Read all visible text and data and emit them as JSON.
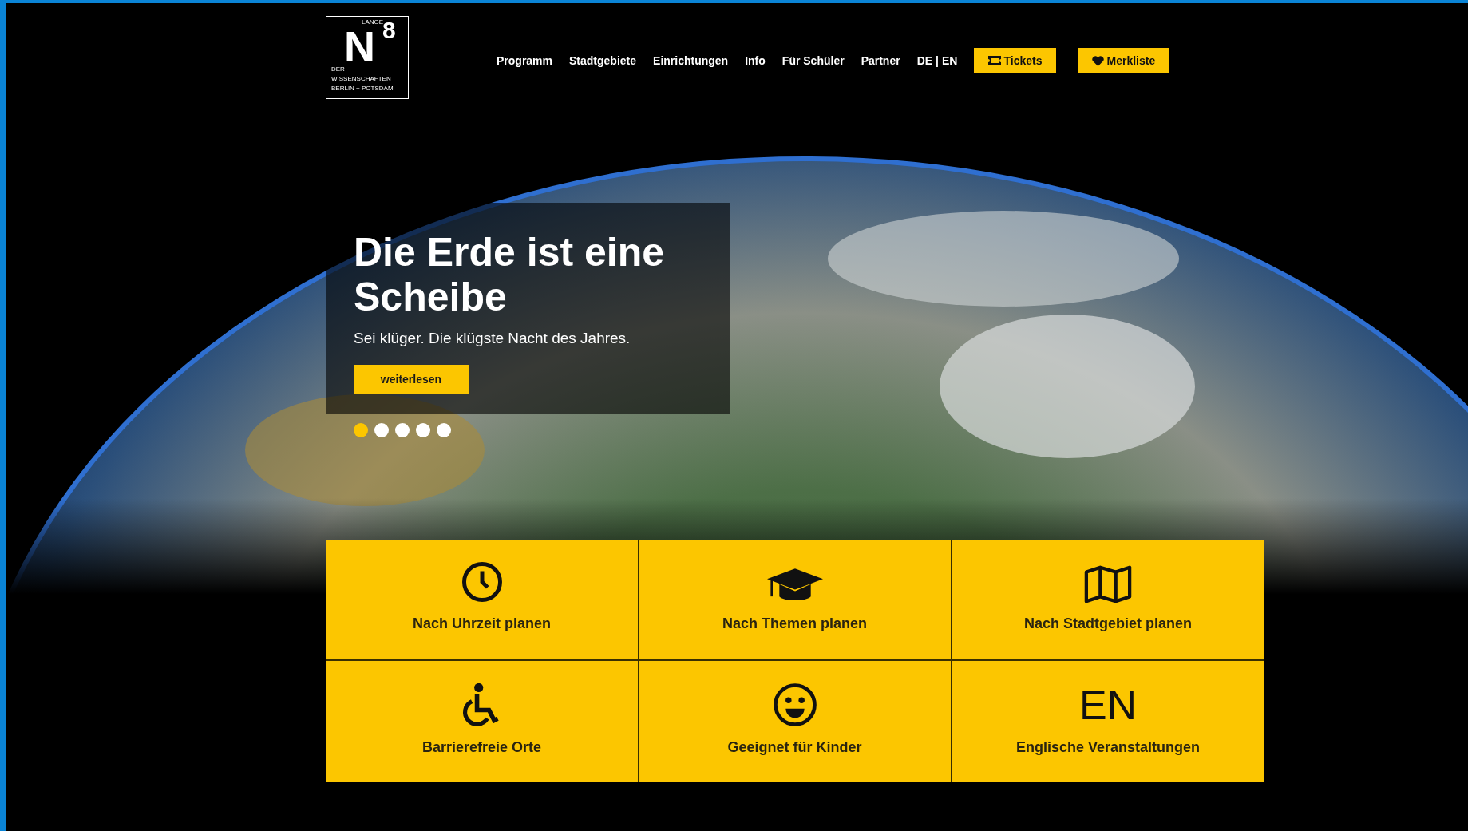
{
  "logo": {
    "top": "LANGE",
    "letter": "N",
    "digit": "8",
    "lines": [
      "DER",
      "WISSENSCHAFTEN",
      "BERLIN + POTSDAM"
    ]
  },
  "nav": [
    "Programm",
    "Stadtgebiete",
    "Einrichtungen",
    "Info",
    "Für Schüler",
    "Partner"
  ],
  "language": {
    "options": [
      "DE",
      "EN"
    ],
    "separator": "|"
  },
  "buttons": [
    {
      "kind": "ticket",
      "label": "Tickets"
    },
    {
      "kind": "heart",
      "label": "Merkliste"
    }
  ],
  "hero": {
    "title": "Die Erde ist eine Scheibe",
    "subtitle": "Sei klüger. Die klügste Nacht des Jahres.",
    "button": "weiterlesen",
    "dots": [
      {
        "selected": true
      },
      {
        "selected": false
      },
      {
        "selected": false
      },
      {
        "selected": false
      },
      {
        "selected": false
      }
    ]
  },
  "tiles": [
    {
      "kind": "clock",
      "label": "Nach Uhrzeit planen"
    },
    {
      "kind": "cap",
      "label": "Nach Themen planen"
    },
    {
      "kind": "map",
      "label": "Nach Stadtgebiet planen"
    },
    {
      "kind": "wheelchair",
      "label": "Barrierefreie Orte"
    },
    {
      "kind": "smiley",
      "label": "Geeignet für Kinder"
    },
    {
      "kind": "text",
      "glyph": "EN",
      "label": "Englische Veranstaltungen"
    }
  ]
}
